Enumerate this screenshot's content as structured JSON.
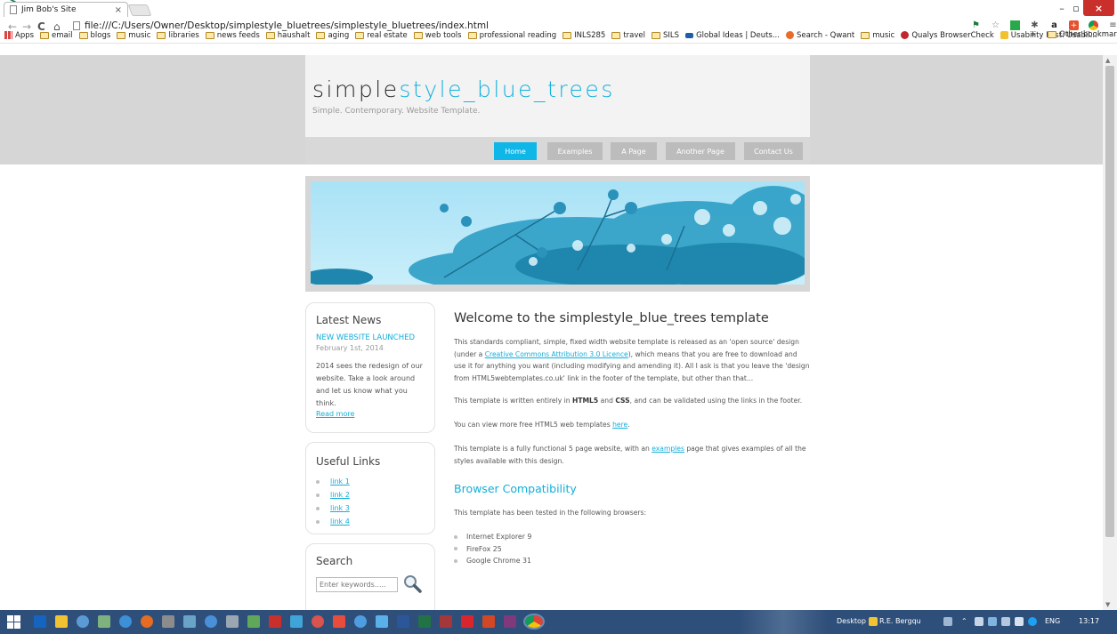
{
  "browser": {
    "tab_title": "Jim Bob's Site",
    "tab_close": "×",
    "win_min": "–",
    "win_max": "▫",
    "win_close": "×",
    "url": "file:///C:/Users/Owner/Desktop/simplestyle_bluetrees/simplestyle_bluetrees/index.html",
    "bookmarks": [
      {
        "label": "Apps"
      },
      {
        "label": "email"
      },
      {
        "label": "blogs"
      },
      {
        "label": "music"
      },
      {
        "label": "libraries"
      },
      {
        "label": "news feeds"
      },
      {
        "label": "haushalt"
      },
      {
        "label": "aging"
      },
      {
        "label": "real estate"
      },
      {
        "label": "web tools"
      },
      {
        "label": "professional reading"
      },
      {
        "label": "INLS285"
      },
      {
        "label": "travel"
      },
      {
        "label": "SILS"
      },
      {
        "label": "Global Ideas | Deuts..."
      },
      {
        "label": "Search - Qwant"
      },
      {
        "label": "music"
      },
      {
        "label": "Qualys BrowserCheck"
      },
      {
        "label": "Usability First: Usabil..."
      }
    ],
    "more_bookmarks": "»",
    "other_bookmarks": "Other bookmarks"
  },
  "site": {
    "logo_part1": "simple",
    "logo_part2": "style_blue_trees",
    "slogan": "Simple. Contemporary. Website Template.",
    "menu": [
      "Home",
      "Examples",
      "A Page",
      "Another Page",
      "Contact Us"
    ],
    "selected_menu": "Home"
  },
  "sidebar": {
    "news": {
      "heading": "Latest News",
      "title": "NEW WEBSITE LAUNCHED",
      "date": "February 1st, 2014",
      "text": "2014 sees the redesign of our website. Take a look around and let us know what you think.",
      "read_more": "Read more"
    },
    "links": {
      "heading": "Useful Links",
      "items": [
        "link 1",
        "link 2",
        "link 3",
        "link 4"
      ]
    },
    "search": {
      "heading": "Search",
      "placeholder": "Enter keywords....."
    }
  },
  "content": {
    "heading": "Welcome to the simplestyle_blue_trees template",
    "p1_a": "This standards compliant, simple, fixed width website template is released as an 'open source' design (under a ",
    "p1_link": "Creative Commons Attribution 3.0 Licence",
    "p1_b": "), which means that you are free to download and use it for anything you want (including modifying and amending it). All I ask is that you leave the 'design from HTML5webtemplates.co.uk' link in the footer of the template, but other than that...",
    "p2_a": "This template is written entirely in ",
    "p2_html5": "HTML5",
    "p2_and": " and ",
    "p2_css": "CSS",
    "p2_b": ", and can be validated using the links in the footer.",
    "p3_a": "You can view more free HTML5 web templates ",
    "p3_link": "here",
    "p3_b": ".",
    "p4_a": "This template is a fully functional 5 page website, with an ",
    "p4_link": "examples",
    "p4_b": " page that gives examples of all the styles available with this design.",
    "compat_heading": "Browser Compatibility",
    "compat_text": "This template has been tested in the following browsers:",
    "browsers": [
      "Internet Explorer 9",
      "FireFox 25",
      "Google Chrome 31"
    ]
  },
  "taskbar": {
    "desktop_label": "Desktop",
    "user_label": "R.E. Bergqu",
    "lang": "ENG",
    "time": "13:17"
  },
  "colors": {
    "accent": "#15b1dc",
    "menu_selected": "#0fb6e8",
    "header_band": "#d6d6d6",
    "taskbar": "#2e4f7a"
  }
}
